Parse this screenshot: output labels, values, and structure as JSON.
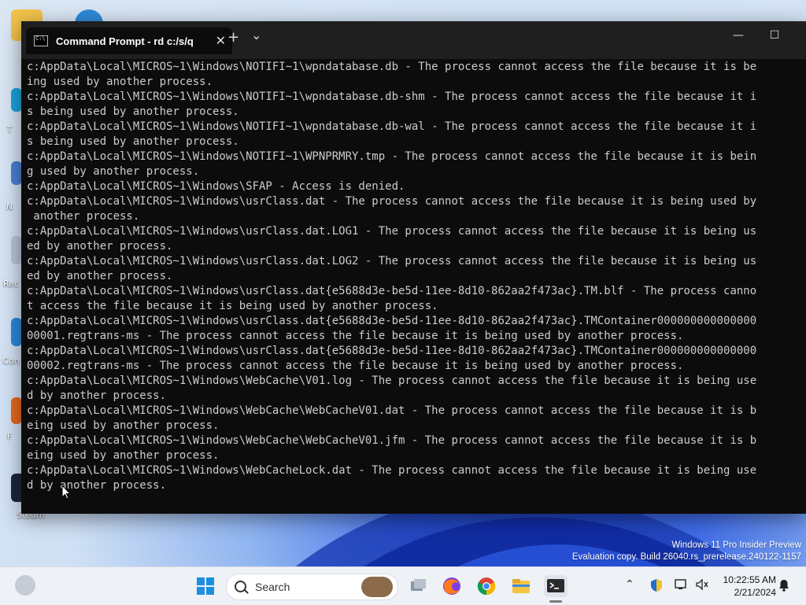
{
  "desktop": {
    "icons": [
      {
        "label": ""
      },
      {
        "label": "T"
      },
      {
        "label": "N"
      },
      {
        "label": "Rec"
      },
      {
        "label": "Con"
      },
      {
        "label": "F"
      },
      {
        "label": "Steam"
      }
    ],
    "watermark_line1": "Windows 11 Pro Insider Preview",
    "watermark_line2": "Evaluation copy. Build 26040.rs_prerelease.240122-1157"
  },
  "window": {
    "tab_title": "Command Prompt - rd  c:/s/q",
    "new_tab": "+",
    "dropdown": "⌄",
    "close_tab": "✕",
    "minimize": "—",
    "maximize": "☐"
  },
  "console_lines": [
    "c:AppData\\Local\\MICROS~1\\Windows\\NOTIFI~1\\wpndatabase.db - The process cannot access the file because it is be",
    "ing used by another process.",
    "c:AppData\\Local\\MICROS~1\\Windows\\NOTIFI~1\\wpndatabase.db-shm - The process cannot access the file because it i",
    "s being used by another process.",
    "c:AppData\\Local\\MICROS~1\\Windows\\NOTIFI~1\\wpndatabase.db-wal - The process cannot access the file because it i",
    "s being used by another process.",
    "c:AppData\\Local\\MICROS~1\\Windows\\NOTIFI~1\\WPNPRMRY.tmp - The process cannot access the file because it is bein",
    "g used by another process.",
    "c:AppData\\Local\\MICROS~1\\Windows\\SFAP - Access is denied.",
    "c:AppData\\Local\\MICROS~1\\Windows\\usrClass.dat - The process cannot access the file because it is being used by",
    " another process.",
    "c:AppData\\Local\\MICROS~1\\Windows\\usrClass.dat.LOG1 - The process cannot access the file because it is being us",
    "ed by another process.",
    "c:AppData\\Local\\MICROS~1\\Windows\\usrClass.dat.LOG2 - The process cannot access the file because it is being us",
    "ed by another process.",
    "c:AppData\\Local\\MICROS~1\\Windows\\usrClass.dat{e5688d3e-be5d-11ee-8d10-862aa2f473ac}.TM.blf - The process canno",
    "t access the file because it is being used by another process.",
    "c:AppData\\Local\\MICROS~1\\Windows\\usrClass.dat{e5688d3e-be5d-11ee-8d10-862aa2f473ac}.TMContainer000000000000000",
    "00001.regtrans-ms - The process cannot access the file because it is being used by another process.",
    "c:AppData\\Local\\MICROS~1\\Windows\\usrClass.dat{e5688d3e-be5d-11ee-8d10-862aa2f473ac}.TMContainer000000000000000",
    "00002.regtrans-ms - The process cannot access the file because it is being used by another process.",
    "c:AppData\\Local\\MICROS~1\\Windows\\WebCache\\V01.log - The process cannot access the file because it is being use",
    "d by another process.",
    "c:AppData\\Local\\MICROS~1\\Windows\\WebCache\\WebCacheV01.dat - The process cannot access the file because it is b",
    "eing used by another process.",
    "c:AppData\\Local\\MICROS~1\\Windows\\WebCache\\WebCacheV01.jfm - The process cannot access the file because it is b",
    "eing used by another process.",
    "c:AppData\\Local\\MICROS~1\\Windows\\WebCacheLock.dat - The process cannot access the file because it is being use",
    "d by another process."
  ],
  "taskbar": {
    "search_placeholder": "Search",
    "time": "10:22:55 AM",
    "date": "2/21/2024"
  },
  "colors": {
    "terminal_bg": "#0c0c0c",
    "titlebar_bg": "#1f1f1f",
    "console_text": "#cccccc",
    "taskbar_bg": "#eef1f6"
  }
}
